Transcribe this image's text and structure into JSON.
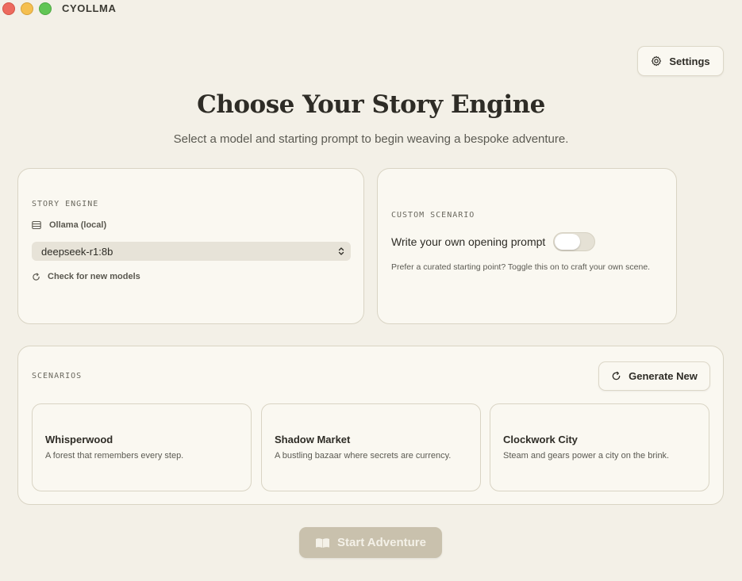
{
  "window": {
    "title": "CYOLLMA"
  },
  "header": {
    "settings_label": "Settings",
    "settings_icon": "gear-icon"
  },
  "hero": {
    "title": "Choose Your Story Engine",
    "subtitle": "Select a model and starting prompt to begin weaving a bespoke adventure."
  },
  "engine": {
    "section_label": "STORY ENGINE",
    "provider": "Ollama (local)",
    "provider_icon": "server-icon",
    "model": "deepseek-r1:8b",
    "refresh_label": "Check for new models",
    "refresh_icon": "refresh-icon"
  },
  "custom": {
    "section_label": "CUSTOM SCENARIO",
    "toggle_label": "Write your own opening prompt",
    "toggle_on": false,
    "hint": "Prefer a curated starting point? Toggle this on to craft your own scene."
  },
  "scenarios": {
    "section_label": "SCENARIOS",
    "generate_label": "Generate New",
    "items": [
      {
        "name": "Whisperwood",
        "description": "A forest that remembers every step."
      },
      {
        "name": "Shadow Market",
        "description": "A bustling bazaar where secrets are currency."
      },
      {
        "name": "Clockwork City",
        "description": "Steam and gears power a city on the brink."
      }
    ]
  },
  "footer": {
    "start_label": "Start Adventure",
    "start_icon": "book-icon",
    "start_enabled": false
  },
  "colors": {
    "background": "#f3f0e7",
    "card": "#faf8f1",
    "start_button_disabled": "#c9c1ad"
  }
}
